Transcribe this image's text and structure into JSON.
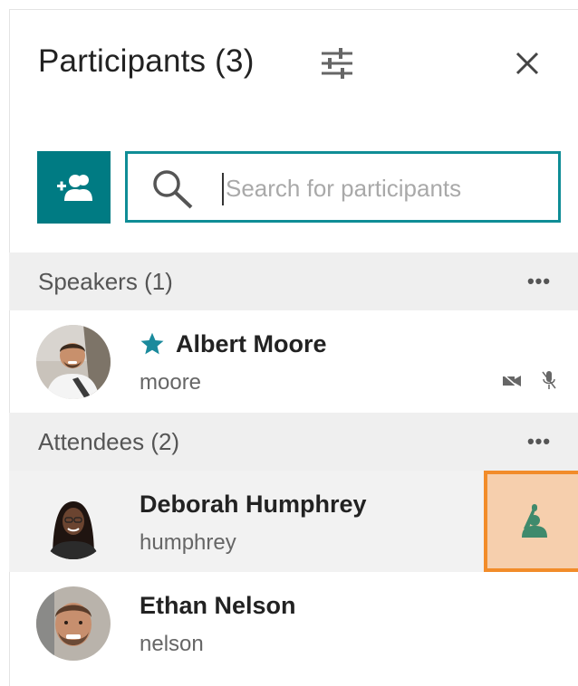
{
  "header": {
    "title": "Participants (3)",
    "filter_icon": "sliders-icon",
    "close_icon": "close-icon"
  },
  "toolbar": {
    "add_icon": "add-participant-icon",
    "search": {
      "placeholder": "Search for participants",
      "value": "",
      "icon": "search-icon"
    }
  },
  "speakers": {
    "label": "Speakers (1)",
    "more_label": "•••",
    "items": [
      {
        "name": "Albert Moore",
        "username": "moore",
        "badge": "star-icon",
        "video": "video-off-icon",
        "mic": "mic-off-icon"
      }
    ]
  },
  "attendees": {
    "label": "Attendees (2)",
    "more_label": "•••",
    "items": [
      {
        "name": "Deborah Humphrey",
        "username": "humphrey",
        "action": "raise-hand-icon"
      },
      {
        "name": "Ethan Nelson",
        "username": "nelson"
      }
    ]
  },
  "colors": {
    "accent": "#007b83",
    "search_border": "#0f8d96",
    "star": "#1a8a9c",
    "hand_bg": "#f6cfad",
    "hand_border": "#f28c2a",
    "hand_icon": "#3f8a6c",
    "section_bg": "#efefef"
  }
}
